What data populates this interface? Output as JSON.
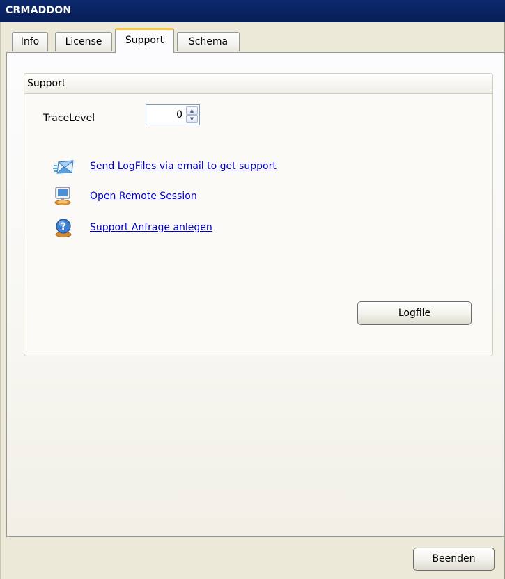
{
  "window": {
    "title": "CRMADDON"
  },
  "tabs": [
    {
      "label": "Info",
      "active": false
    },
    {
      "label": "License",
      "active": false
    },
    {
      "label": "Support",
      "active": true
    },
    {
      "label": "Schema",
      "active": false
    }
  ],
  "support": {
    "group_title": "Support",
    "trace_level_label": "TraceLevel",
    "trace_level_value": "0",
    "links": [
      {
        "icon": "email-icon",
        "label": "Send LogFiles via email to get support"
      },
      {
        "icon": "remote-desktop-icon",
        "label": "Open Remote Session"
      },
      {
        "icon": "help-icon",
        "label": "Support Anfrage anlegen"
      }
    ],
    "logfile_button": "Logfile"
  },
  "footer": {
    "close_button": "Beenden"
  },
  "colors": {
    "title_bar": "#0a2463",
    "link": "#0000cc",
    "tab_highlight": "#ffc83c",
    "dialog_background": "#ece9d8"
  }
}
